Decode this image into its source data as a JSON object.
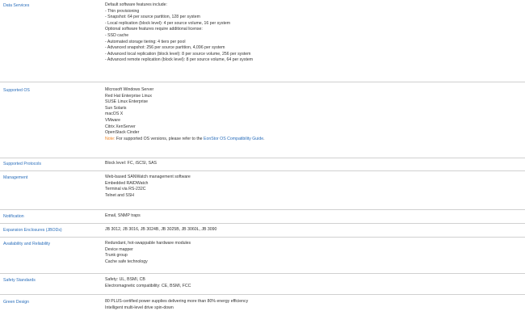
{
  "rows": {
    "data_services": {
      "label": "Data Services",
      "lines": [
        "Default software features include:",
        "- Thin provisioning",
        "- Snapshot: 64 per source partition, 128 per system",
        "- Local replication (block level): 4 per source volume, 16 per system",
        "Optional software features require additional license:",
        "- SSD cache",
        "- Automated storage tiering: 4 tiers per pool",
        "- Advanced snapshot: 256 per source partition, 4,096 per system",
        "- Advanced local replication (block level): 8 per source volume, 256 per system",
        "- Advanced remote replication (block level): 8 per source volume, 64 per system"
      ]
    },
    "supported_os": {
      "label": "Supported OS",
      "lines": [
        "Microsoft Windows Server",
        "Red Hat Enterprise Linux",
        "SUSE Linux Enterprise",
        "Sun Solaris",
        "macOS X",
        "VMware",
        "Citrix XenServer",
        "OpenStack Cinder"
      ],
      "note_label": "Note:",
      "note_text": " For supported OS versions, please refer to the ",
      "note_link": "EonStor OS Compatibility Guide",
      "note_end": "."
    },
    "supported_protocols": {
      "label": "Supported Protocols",
      "lines": [
        "Block level: FC, iSCSI, SAS"
      ]
    },
    "management": {
      "label": "Management",
      "lines": [
        "Web-based SANWatch management software",
        "Embedded RAIDWatch",
        "Terminal via RS-232C",
        "Telnet and SSH"
      ]
    },
    "notification": {
      "label": "Notification",
      "lines": [
        "Email, SNMP traps"
      ]
    },
    "expansion": {
      "label": "Expansion Enclosures (JBODs)",
      "lines": [
        "JB 3012, JB 3016, JB 3024B, JB 3025B, JB 3060L, JB 3090"
      ]
    },
    "availability": {
      "label": "Availability and Reliability",
      "lines": [
        "Redundant, hot-swappable hardware modules",
        "Device mapper",
        "Trunk group",
        "Cache safe technology"
      ]
    },
    "safety": {
      "label": "Safety Standards",
      "lines": [
        "Safety: UL, BSMI, CB",
        "Electromagnetic compatibility: CE, BSMI, FCC"
      ]
    },
    "green": {
      "label": "Green Design",
      "lines": [
        "80 PLUS-certified power supplies delivering more than 80% energy efficiency",
        "Intelligent multi-level drive spin-down"
      ]
    }
  },
  "colors": {
    "label": "#2a6ebb",
    "text": "#333333",
    "note": "#f0821e",
    "divider": "#d0d0d0"
  }
}
